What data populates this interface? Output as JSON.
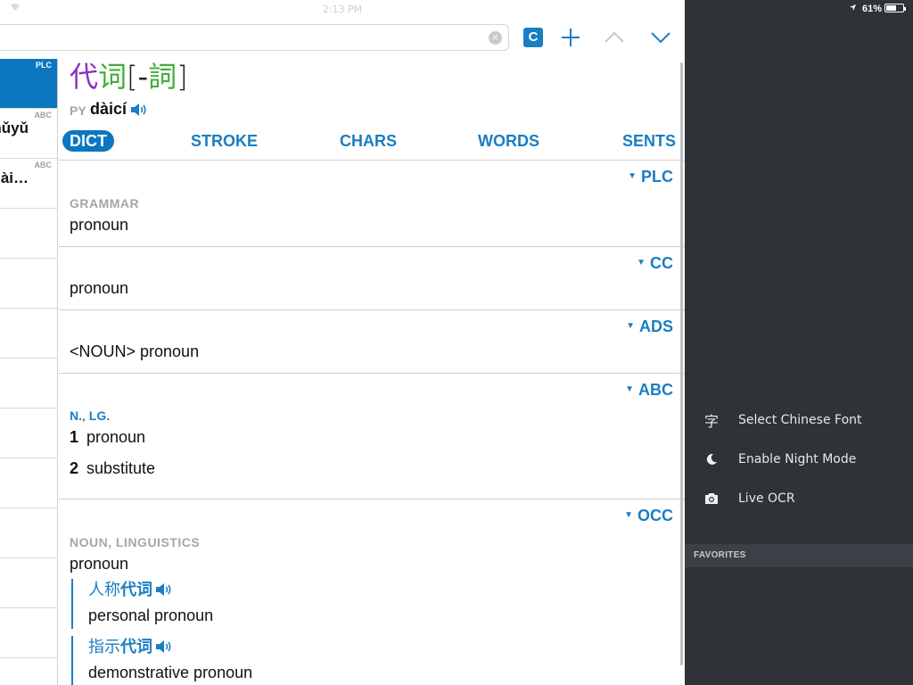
{
  "status_bar": {
    "time": "2:13 PM",
    "battery_text": "61%",
    "battery_level": 0.61
  },
  "toolbar": {
    "search_value": "",
    "clear_glyph": "×",
    "badge_label": "C",
    "icons": [
      "add-icon",
      "chevron-up-icon",
      "chevron-down-icon"
    ]
  },
  "result_list": [
    {
      "source": "PLC",
      "text": "",
      "selected": true
    },
    {
      "source": "ABC",
      "text": "nǔyǔ",
      "selected": false
    },
    {
      "source": "ABC",
      "text": "ài…",
      "selected": false
    },
    {
      "source": "",
      "text": "",
      "selected": false
    },
    {
      "source": "",
      "text": "",
      "selected": false
    },
    {
      "source": "",
      "text": "",
      "selected": false
    },
    {
      "source": "",
      "text": "",
      "selected": false
    },
    {
      "source": "",
      "text": "",
      "selected": false
    },
    {
      "source": "",
      "text": "",
      "selected": false
    },
    {
      "source": "",
      "text": "",
      "selected": false
    },
    {
      "source": "",
      "text": "",
      "selected": false
    },
    {
      "source": "",
      "text": "",
      "selected": false
    },
    {
      "source": "",
      "text": "",
      "selected": false
    }
  ],
  "entry": {
    "simplified_c1": "代",
    "simplified_c2": "词",
    "bracket_open": "[",
    "trad_dash": "-",
    "trad_c2": "詞",
    "bracket_close": "]",
    "py_label": "PY",
    "pinyin": "dàicí",
    "colors": {
      "tone4": "#8b2fc9",
      "tone2": "#3fae3b",
      "accent": "#1a7ec3"
    }
  },
  "tabs": {
    "dict": "DICT",
    "stroke": "STROKE",
    "chars": "CHARS",
    "words": "WORDS",
    "sents": "SENTS"
  },
  "sections": {
    "plc": {
      "source": "PLC",
      "label": "GRAMMAR",
      "definition": "pronoun"
    },
    "cc": {
      "source": "CC",
      "definition": "pronoun"
    },
    "ads": {
      "source": "ADS",
      "definition": "<NOUN> pronoun"
    },
    "abc": {
      "source": "ABC",
      "pos_a": "N.",
      "pos_sep": ", ",
      "pos_b": "LG.",
      "senses": [
        {
          "num": "1",
          "text": "pronoun"
        },
        {
          "num": "2",
          "text": "substitute"
        }
      ]
    },
    "occ": {
      "source": "OCC",
      "label": "NOUN, LINGUISTICS",
      "definition": "pronoun",
      "examples": [
        {
          "zh_prefix": "人称",
          "zh_highlight": "代词",
          "en": "personal pronoun"
        },
        {
          "zh_prefix": "指示",
          "zh_highlight": "代词",
          "en": "demonstrative pronoun"
        }
      ]
    }
  },
  "side_menu": {
    "items": [
      {
        "icon": "字",
        "label": "Select Chinese Font"
      },
      {
        "icon": "moon-icon",
        "label": "Enable Night Mode"
      },
      {
        "icon": "camera-icon",
        "label": "Live OCR"
      }
    ],
    "favorites_header": "FAVORITES"
  }
}
